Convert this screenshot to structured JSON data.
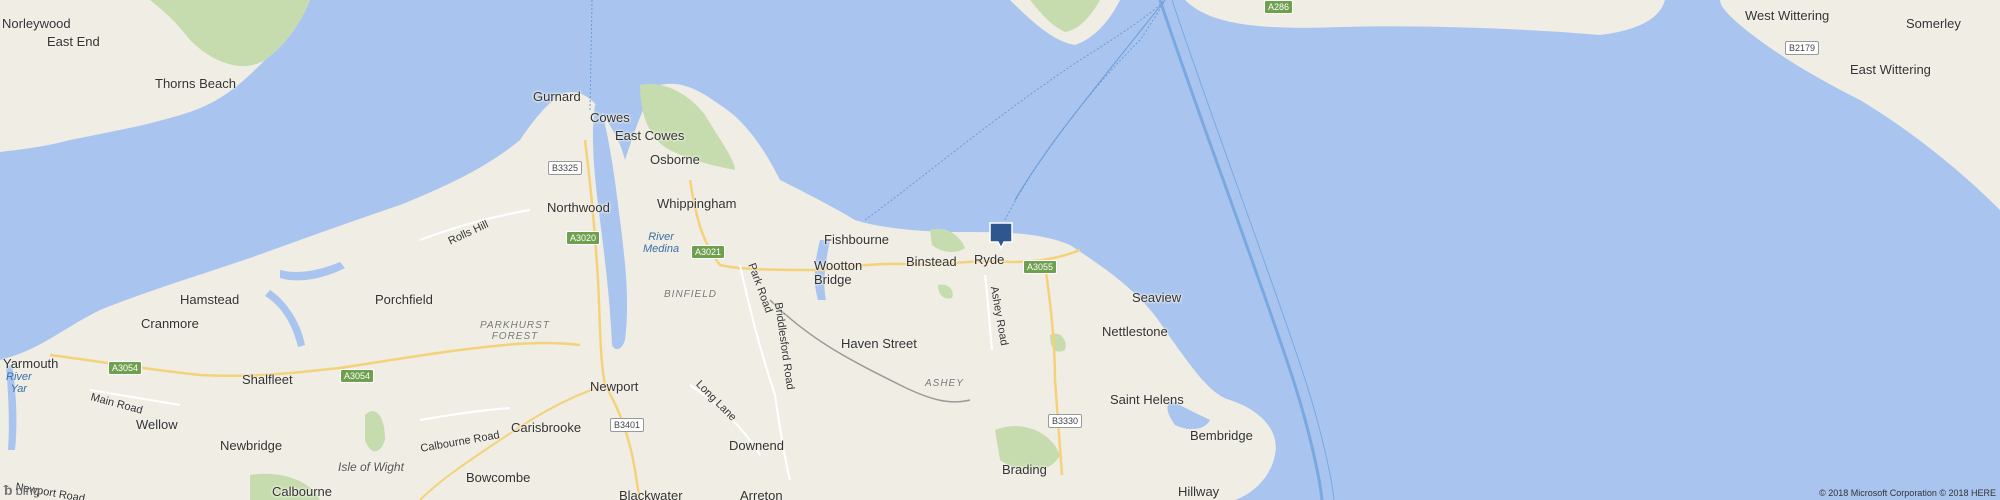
{
  "map": {
    "colors": {
      "sea": "#a9c5ef",
      "land": "#efede4",
      "park": "#c6dcae",
      "road_major": "#f5d27a",
      "road_minor": "#ffffff",
      "marker": "#2f568f"
    },
    "places": [
      {
        "key": "norleywood",
        "label": "Norleywood"
      },
      {
        "key": "east-end",
        "label": "East End"
      },
      {
        "key": "thorns-beach",
        "label": "Thorns Beach"
      },
      {
        "key": "gurnard",
        "label": "Gurnard"
      },
      {
        "key": "cowes",
        "label": "Cowes"
      },
      {
        "key": "east-cowes",
        "label": "East Cowes"
      },
      {
        "key": "osborne",
        "label": "Osborne"
      },
      {
        "key": "northwood",
        "label": "Northwood"
      },
      {
        "key": "whippingham",
        "label": "Whippingham"
      },
      {
        "key": "fishbourne",
        "label": "Fishbourne"
      },
      {
        "key": "wootton-bridge",
        "label": "Wootton\nBridge"
      },
      {
        "key": "binstead",
        "label": "Binstead"
      },
      {
        "key": "ryde",
        "label": "Ryde"
      },
      {
        "key": "seaview",
        "label": "Seaview"
      },
      {
        "key": "nettlestone",
        "label": "Nettlestone"
      },
      {
        "key": "hamstead",
        "label": "Hamstead"
      },
      {
        "key": "porchfield",
        "label": "Porchfield"
      },
      {
        "key": "cranmore",
        "label": "Cranmore"
      },
      {
        "key": "haven-street",
        "label": "Haven Street"
      },
      {
        "key": "yarmouth",
        "label": "Yarmouth"
      },
      {
        "key": "shalfleet",
        "label": "Shalfleet"
      },
      {
        "key": "newport",
        "label": "Newport"
      },
      {
        "key": "wellow",
        "label": "Wellow"
      },
      {
        "key": "carisbrooke",
        "label": "Carisbrooke"
      },
      {
        "key": "newbridge",
        "label": "Newbridge"
      },
      {
        "key": "downend",
        "label": "Downend"
      },
      {
        "key": "saint-helens",
        "label": "Saint Helens"
      },
      {
        "key": "bembridge",
        "label": "Bembridge"
      },
      {
        "key": "brading",
        "label": "Brading"
      },
      {
        "key": "bowcombe",
        "label": "Bowcombe"
      },
      {
        "key": "calbourne",
        "label": "Calbourne"
      },
      {
        "key": "blackwater",
        "label": "Blackwater"
      },
      {
        "key": "arreton",
        "label": "Arreton"
      },
      {
        "key": "hillway",
        "label": "Hillway"
      },
      {
        "key": "west-wittering",
        "label": "West Wittering"
      },
      {
        "key": "somerley",
        "label": "Somerley"
      },
      {
        "key": "east-wittering",
        "label": "East Wittering"
      }
    ],
    "roads": {
      "rolls_hill": "Rolls Hill",
      "park_road": "Park Road",
      "briddlesford_road": "Briddlesford Road",
      "ashey_road": "Ashey Road",
      "long_lane": "Long Lane",
      "main_road": "Main Road",
      "calbourne_road": "Calbourne Road",
      "newport_road": "Newport Road"
    },
    "areas": {
      "binfield": "BINFIELD",
      "parkhurst_forest": "PARKHURST\nFOREST",
      "ashey": "ASHEY",
      "isle_of_wight": "Isle of Wight"
    },
    "water": {
      "river_medina": "River\nMedina",
      "river_yar": "River\nYar"
    },
    "shields": {
      "b3325": "B3325",
      "a3020": "A3020",
      "a3021": "A3021",
      "a3055": "A3055",
      "a3054_east": "A3054",
      "a3054_west": "A3054",
      "b3330": "B3330",
      "b3401": "B3401",
      "a286": "A286",
      "b2179": "B2179"
    },
    "marker_label": "location-marker",
    "attribution": {
      "bing": "bing",
      "copyright": "© 2018 Microsoft Corporation © 2018 HERE"
    }
  }
}
